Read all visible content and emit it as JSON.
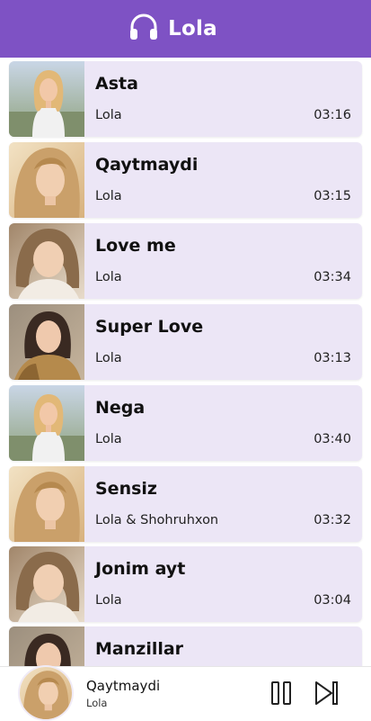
{
  "header": {
    "title": "Lola",
    "icon": "headphones-icon",
    "background": "#7e52c4"
  },
  "songs": [
    {
      "title": "Asta",
      "artist": "Lola",
      "duration": "03:16",
      "cover": "cover-1"
    },
    {
      "title": "Qaytmaydi",
      "artist": "Lola",
      "duration": "03:15",
      "cover": "cover-2"
    },
    {
      "title": "Love me",
      "artist": "Lola",
      "duration": "03:34",
      "cover": "cover-3"
    },
    {
      "title": "Super Love",
      "artist": "Lola",
      "duration": "03:13",
      "cover": "cover-4"
    },
    {
      "title": "Nega",
      "artist": "Lola",
      "duration": "03:40",
      "cover": "cover-1"
    },
    {
      "title": "Sensiz",
      "artist": "Lola & Shohruhxon",
      "duration": "03:32",
      "cover": "cover-2"
    },
    {
      "title": "Jonim ayt",
      "artist": "Lola",
      "duration": "03:04",
      "cover": "cover-3"
    },
    {
      "title": "Manzillar",
      "artist": "",
      "duration": "",
      "cover": "cover-4"
    }
  ],
  "player": {
    "title": "Qaytmaydi",
    "artist": "Lola",
    "pause_icon": "pause-icon",
    "next_icon": "skip-next-icon"
  },
  "colors": {
    "accent": "#7e52c4",
    "card": "#ece6f6"
  }
}
